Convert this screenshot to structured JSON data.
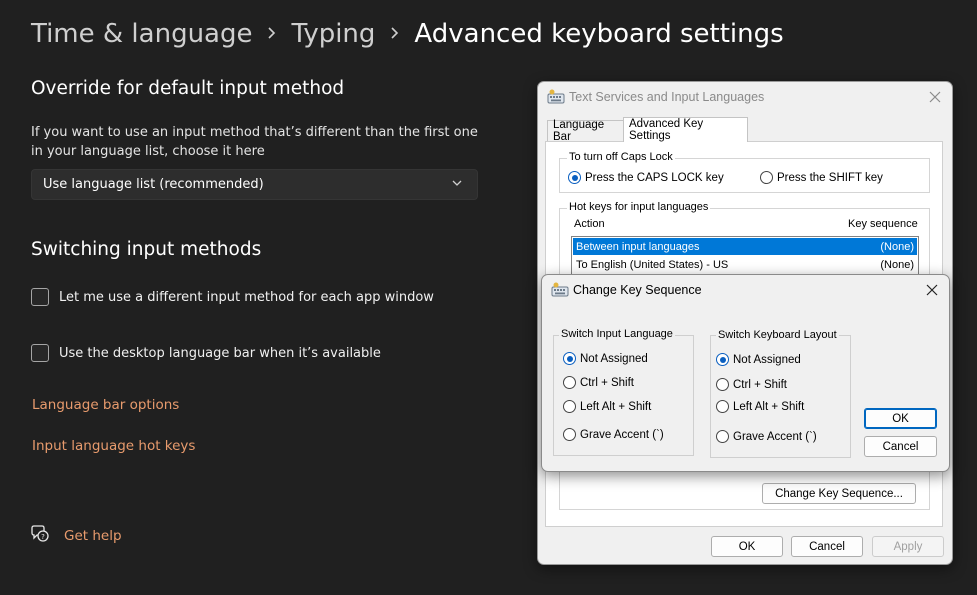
{
  "breadcrumb": {
    "items": [
      "Time & language",
      "Typing"
    ],
    "current": "Advanced keyboard settings"
  },
  "override": {
    "heading": "Override for default input method",
    "description": "If you want to use an input method that’s different than the first one in your language list, choose it here",
    "dropdown_value": "Use language list (recommended)"
  },
  "switching": {
    "heading": "Switching input methods",
    "checkbox1": {
      "label": "Let me use a different input method for each app window",
      "checked": false
    },
    "checkbox2": {
      "label": "Use the desktop language bar when it’s available",
      "checked": false
    }
  },
  "links": {
    "language_bar_options": "Language bar options",
    "input_language_hot_keys": "Input language hot keys",
    "get_help": "Get help"
  },
  "text_services_dialog": {
    "title": "Text Services and Input Languages",
    "tabs": [
      "Language Bar",
      "Advanced Key Settings"
    ],
    "active_tab": "Advanced Key Settings",
    "caps_lock_group": "To turn off Caps Lock",
    "caps_options": [
      "Press the CAPS LOCK key",
      "Press the SHIFT key"
    ],
    "caps_selected": "Press the CAPS LOCK key",
    "hotkeys_group": "Hot keys for input languages",
    "col_action": "Action",
    "col_key_sequence": "Key sequence",
    "rows": [
      {
        "action": "Between input languages",
        "key": "(None)",
        "selected": true
      },
      {
        "action": "To English (United States) - US",
        "key": "(None)",
        "selected": false
      }
    ],
    "change_key_sequence_button": "Change Key Sequence...",
    "ok": "OK",
    "cancel": "Cancel",
    "apply": "Apply"
  },
  "change_key_dialog": {
    "title": "Change Key Sequence",
    "input_language_group": "Switch Input Language",
    "input_language_options": [
      "Not Assigned",
      "Ctrl + Shift",
      "Left Alt + Shift",
      "Grave Accent (`)"
    ],
    "input_language_selected": "Not Assigned",
    "keyboard_layout_group": "Switch Keyboard Layout",
    "keyboard_layout_options": [
      "Not Assigned",
      "Ctrl + Shift",
      "Left Alt + Shift",
      "Grave Accent (`)"
    ],
    "keyboard_layout_selected": "Not Assigned",
    "ok": "OK",
    "cancel": "Cancel"
  },
  "colors": {
    "background": "#202020",
    "link": "#e89b6d",
    "selection": "#0078d7",
    "radio_selected": "#0a5fc0"
  }
}
